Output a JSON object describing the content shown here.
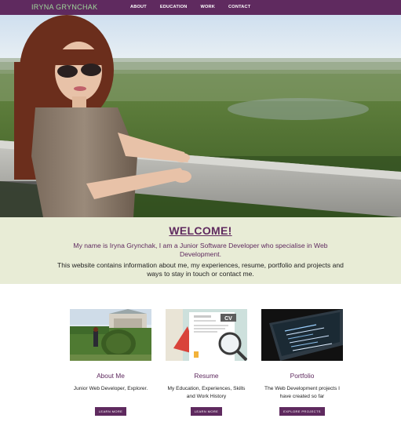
{
  "nav": {
    "brand": "IRYNA GRYNCHAK",
    "links": [
      "ABOUT",
      "EDUCATION",
      "WORK",
      "CONTACT"
    ]
  },
  "welcome": {
    "title": "WELCOME!",
    "intro": "My name is Iryna Grynchak, I am a Junior Software Developer who specialise in Web Development.",
    "info": "This website contains information about me, my experiences, resume, portfolio and projects and ways to stay in touch or contact me."
  },
  "cards": [
    {
      "title": "About Me",
      "description": "Junior Web Developer, Explorer.",
      "button": "LEARN MORE"
    },
    {
      "title": "Resume",
      "description": "My Education, Experiences, Skills and Work History",
      "button": "LEARN MORE"
    },
    {
      "title": "Portfolio",
      "description": "The Web Development projects I have created so far",
      "button": "EXPLORE PROJECTS"
    }
  ],
  "images": {
    "hero": "photo of woman leaning on stone railing over landscape",
    "cv_label": "CV"
  },
  "colors": {
    "primary": "#5f2a5f",
    "brand": "#9fd89a",
    "welcome_bg": "#e8ecd6"
  }
}
